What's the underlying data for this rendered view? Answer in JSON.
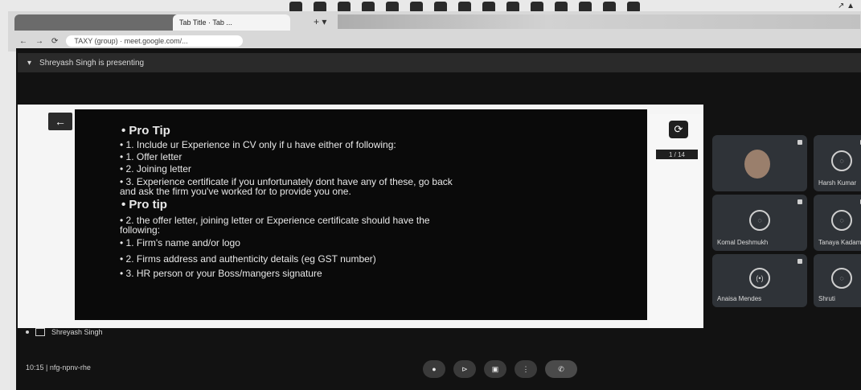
{
  "browser": {
    "tab1_title": "",
    "tab2_title": "Tab Title · Tab ...",
    "url": "TAXY (group) · meet.google.com/...",
    "tray_text": "↗ ▲"
  },
  "banner": {
    "presenting_text": "Shreyash Singh is presenting"
  },
  "slide": {
    "lines": [
      {
        "text": "• Pro Tip",
        "kind": "head"
      },
      {
        "text": "• 1. Include ur Experience in CV only if u have either of following:",
        "kind": "body"
      },
      {
        "text": "• 1. Offer letter",
        "kind": "body"
      },
      {
        "text": "• 2. Joining letter",
        "kind": "body"
      },
      {
        "text": "• 3. Experience certificate if you unfortunately dont have any of these, go back",
        "kind": "body"
      },
      {
        "text": "   and ask the firm you've worked for to provide you one.",
        "kind": "body"
      },
      {
        "text": "• Pro tip",
        "kind": "head"
      },
      {
        "text": "• 2. the offer letter, joining letter or Experience certificate should have the",
        "kind": "body"
      },
      {
        "text": "   following:",
        "kind": "body"
      },
      {
        "text": "• 1. Firm's name and/or logo",
        "kind": "body"
      },
      {
        "text": "• 2. Firms address and authenticity details (eg GST number)",
        "kind": "body"
      },
      {
        "text": "• 3. HR person or your Boss/mangers signature",
        "kind": "body"
      }
    ]
  },
  "presentation": {
    "page_counter": "1 / 14",
    "presenter_name": "Shreyash Singh"
  },
  "participants": [
    {
      "name": "",
      "type": "video"
    },
    {
      "name": "Harsh Kumar",
      "type": "avatar"
    },
    {
      "name": "Komal Deshmukh",
      "type": "avatar"
    },
    {
      "name": "Tanaya Kadam",
      "type": "avatar"
    },
    {
      "name": "Anaisa Mendes",
      "type": "mic"
    },
    {
      "name": "Shruti",
      "type": "avatar"
    }
  ],
  "meeting": {
    "time_code": "10:15  |  nfg-npnv-rhe"
  },
  "controls": {
    "mic": "●",
    "camera": "⊳",
    "present": "▣",
    "more": "⋮",
    "end": "✆"
  },
  "icons": {
    "back": "←",
    "sync": "⟳"
  }
}
